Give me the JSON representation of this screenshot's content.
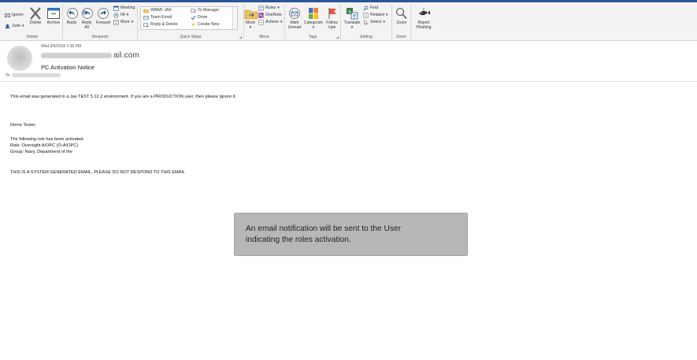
{
  "ribbon": {
    "delete_group": {
      "label": "Delete",
      "ignore": "Ignore",
      "junk": "Junk",
      "delete": "Delete",
      "archive": "Archive"
    },
    "respond_group": {
      "label": "Respond",
      "reply": "Reply",
      "reply_all_line1": "Reply",
      "reply_all_line2": "All",
      "forward": "Forward",
      "meeting": "Meeting",
      "im": "IM",
      "more": "More"
    },
    "quick_steps_group": {
      "label": "Quick Steps",
      "items": [
        "WAWF JAX",
        "To Manager",
        "Team Email",
        "Done",
        "Reply & Delete",
        "Create New"
      ]
    },
    "move_group": {
      "label": "Move",
      "move": "Move",
      "rules": "Rules",
      "onenote": "OneNote",
      "actions": "Actions"
    },
    "tags_group": {
      "label": "Tags",
      "mark_unread_line1": "Mark",
      "mark_unread_line2": "Unread",
      "categorize": "Categorize",
      "follow_up_line1": "Follow",
      "follow_up_line2": "Up"
    },
    "editing_group": {
      "label": "Editing",
      "translate": "Translate",
      "find": "Find",
      "related": "Related",
      "select": "Select"
    },
    "zoom_group": {
      "label": "Zoom",
      "zoom": "Zoom"
    },
    "phishing": {
      "line1": "Report",
      "line2": "Phishing"
    }
  },
  "message": {
    "date": "Wed 9/5/2018 2:36 PM",
    "sender_suffix": "ail.com",
    "subject": "PC Activation Notice",
    "to_label": "To",
    "body_lines": [
      "This email was generated in a Jax TEST 5.12.2 environment. If you are a PRODUCTION user, then please ignore it.",
      "Demo Tester,",
      "The following role has been activated:",
      "Role: Oversight A/OPC (O-A/OPC)",
      "Group: Navy, Department of the",
      "THIS IS A SYSTEM GENERATED EMAIL, PLEASE DO NOT RESPOND TO THIS EMAIL"
    ]
  },
  "callout": {
    "text_line1": "An email notification will be sent to the User",
    "text_line2": "indicating the roles activation."
  },
  "colors": {
    "accent": "#2b579a",
    "ribbon_bg": "#f3f3f3",
    "callout_bg": "#b7b7b7"
  }
}
